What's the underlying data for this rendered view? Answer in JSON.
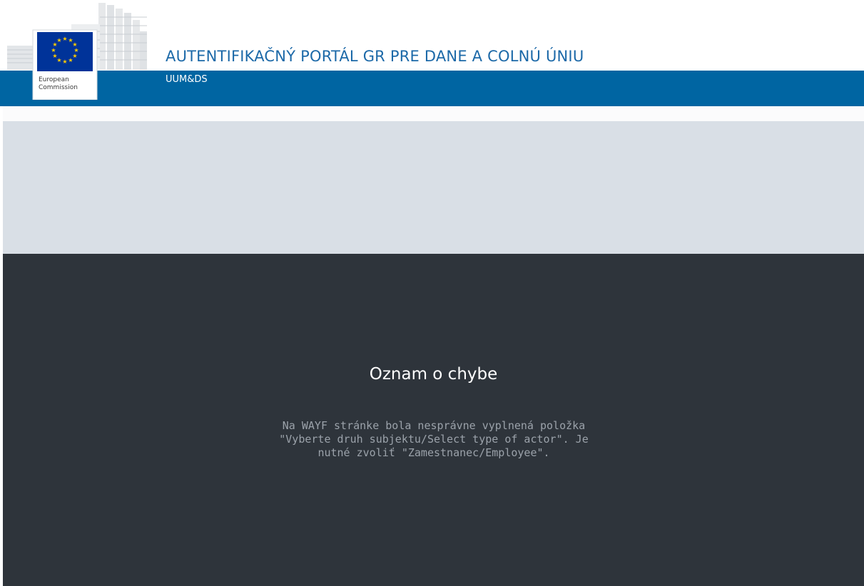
{
  "header": {
    "title": "AUTENTIFIKAČNÝ PORTÁL GR PRE DANE A COLNÚ ÚNIU",
    "subtitle": "UUM&DS",
    "logo_text_line1": "European",
    "logo_text_line2": "Commission"
  },
  "error": {
    "title": "Oznam o chybe",
    "message": "Na WAYF stránke bola nesprávne vyplnená položka \"Vyberte druh subjektu/Select type of actor\". Je nutné zvoliť \"Zamestnanec/Employee\"."
  },
  "colors": {
    "brand_blue": "#0065a2",
    "title_blue": "#1c69a8",
    "grey_band": "#d9dfe6",
    "dark_panel": "#2e343b",
    "eu_flag_blue": "#003399",
    "eu_star_yellow": "#ffcc00"
  }
}
